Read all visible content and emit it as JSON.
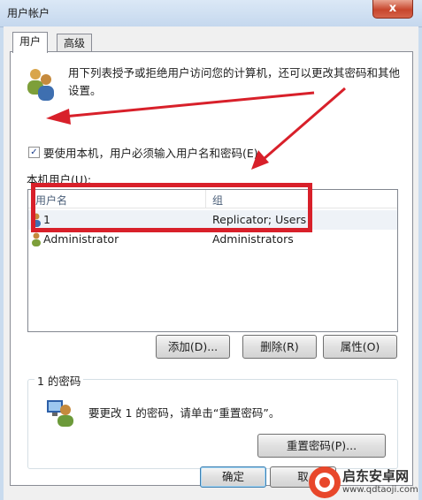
{
  "window": {
    "title": "用户帐户",
    "close_glyph": "x"
  },
  "tabs": [
    {
      "label": "用户",
      "active": true
    },
    {
      "label": "高级",
      "active": false
    }
  ],
  "description": "用下列表授予或拒绝用户访问您的计算机，还可以更改其密码和其他设置。",
  "require_login": {
    "label": "要使用本机，用户必须输入用户名和密码(E)",
    "checked": true,
    "check_glyph": "✓"
  },
  "users_list": {
    "label": "本机用户(U):",
    "columns": [
      "用户名",
      "组"
    ],
    "rows": [
      {
        "name": "1",
        "group": "Replicator; Users"
      },
      {
        "name": "Administrator",
        "group": "Administrators"
      }
    ]
  },
  "list_buttons": {
    "add": "添加(D)...",
    "delete": "删除(R)",
    "properties": "属性(O)"
  },
  "password_group": {
    "title": "1 的密码",
    "text": "要更改 1 的密码，请单击“重置密码”。",
    "reset_button": "重置密码(P)..."
  },
  "footer_buttons": {
    "ok": "确定",
    "cancel": "取"
  },
  "watermark": {
    "name": "启东安卓网",
    "url": "www.qdtaoji.com"
  },
  "colors": {
    "annotation_red": "#d8202a",
    "accent_blue": "#3c7fb1"
  },
  "icons": [
    "users-icon",
    "user-icon",
    "computer-user-icon",
    "check-icon",
    "close-icon"
  ]
}
